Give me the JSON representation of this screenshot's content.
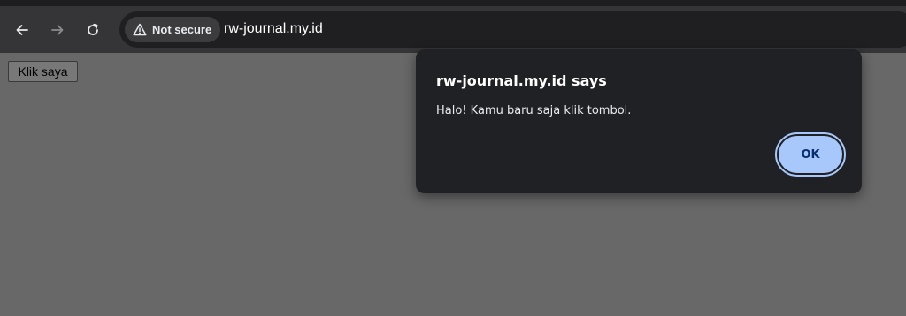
{
  "browser": {
    "nav": {
      "back_icon": "arrow-left-icon",
      "forward_icon": "arrow-right-icon",
      "reload_icon": "reload-icon"
    },
    "omnibox": {
      "security_label": "Not secure",
      "security_icon": "warning-triangle-icon",
      "url": "rw-journal.my.id"
    }
  },
  "page": {
    "button_label": "Klik saya"
  },
  "dialog": {
    "title": "rw-journal.my.id says",
    "message": "Halo! Kamu baru saja klik tombol.",
    "ok_label": "OK"
  },
  "colors": {
    "toolbar": "#353538",
    "omnibox": "#1f1f21",
    "dialog_bg": "#202124",
    "ok_button": "#a8c7fa",
    "page_dimmed": "#686868"
  }
}
